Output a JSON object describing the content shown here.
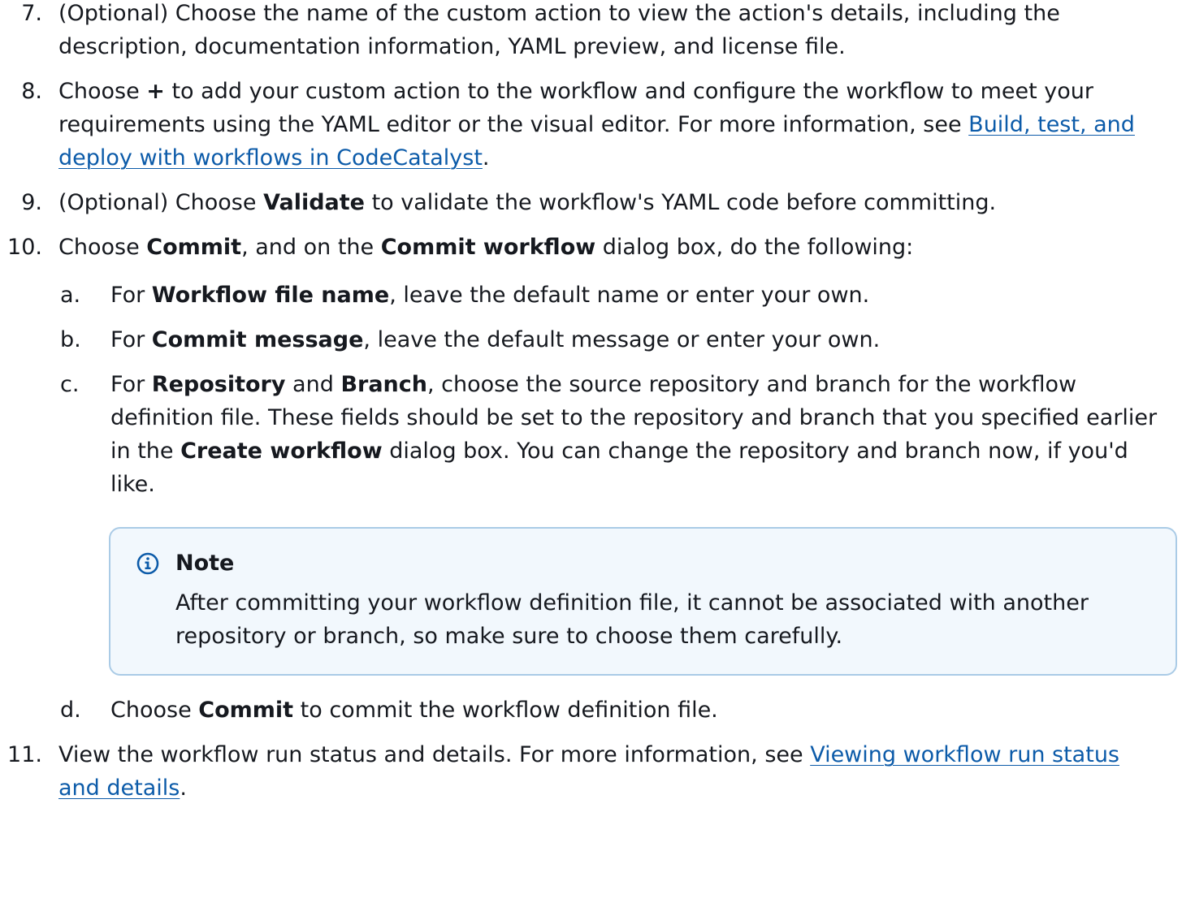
{
  "steps": {
    "s7": {
      "num": "7.",
      "text": "(Optional) Choose the name of the custom action to view the action's details, including the description, documentation information, YAML preview, and license file."
    },
    "s8": {
      "num": "8.",
      "t1": "Choose ",
      "b1": "+",
      "t2": " to add your custom action to the workflow and configure the workflow to meet your requirements using the YAML editor or the visual editor. For more information, see ",
      "link": "Build, test, and deploy with workflows in CodeCatalyst",
      "t3": "."
    },
    "s9": {
      "num": "9.",
      "t1": "(Optional) Choose ",
      "b1": "Validate",
      "t2": " to validate the workflow's YAML code before committing."
    },
    "s10": {
      "num": "10.",
      "t1": "Choose ",
      "b1": "Commit",
      "t2": ", and on the ",
      "b2": "Commit workflow",
      "t3": " dialog box, do the following:",
      "a": {
        "letter": "a.",
        "t1": "For ",
        "b1": "Workflow file name",
        "t2": ", leave the default name or enter your own."
      },
      "b": {
        "letter": "b.",
        "t1": "For ",
        "b1": "Commit message",
        "t2": ", leave the default message or enter your own."
      },
      "c": {
        "letter": "c.",
        "t1": "For ",
        "b1": "Repository",
        "t2": " and ",
        "b2": "Branch",
        "t3": ", choose the source repository and branch for the workflow definition file. These fields should be set to the repository and branch that you specified earlier in the ",
        "b3": "Create workflow",
        "t4": " dialog box. You can change the repository and branch now, if you'd like."
      },
      "note": {
        "title": "Note",
        "body": "After committing your workflow definition file, it cannot be associated with another repository or branch, so make sure to choose them carefully."
      },
      "d": {
        "letter": "d.",
        "t1": "Choose ",
        "b1": "Commit",
        "t2": " to commit the workflow definition file."
      }
    },
    "s11": {
      "num": "11.",
      "t1": "View the workflow run status and details. For more information, see ",
      "link": "Viewing workflow run status and details",
      "t2": "."
    }
  },
  "colors": {
    "text": "#16191f",
    "link": "#0c5ba9",
    "note_border": "#aacbe6",
    "note_bg": "#f2f8fd",
    "info_icon": "#0c5ba9"
  },
  "icons": {
    "note": "info-circle-icon"
  }
}
